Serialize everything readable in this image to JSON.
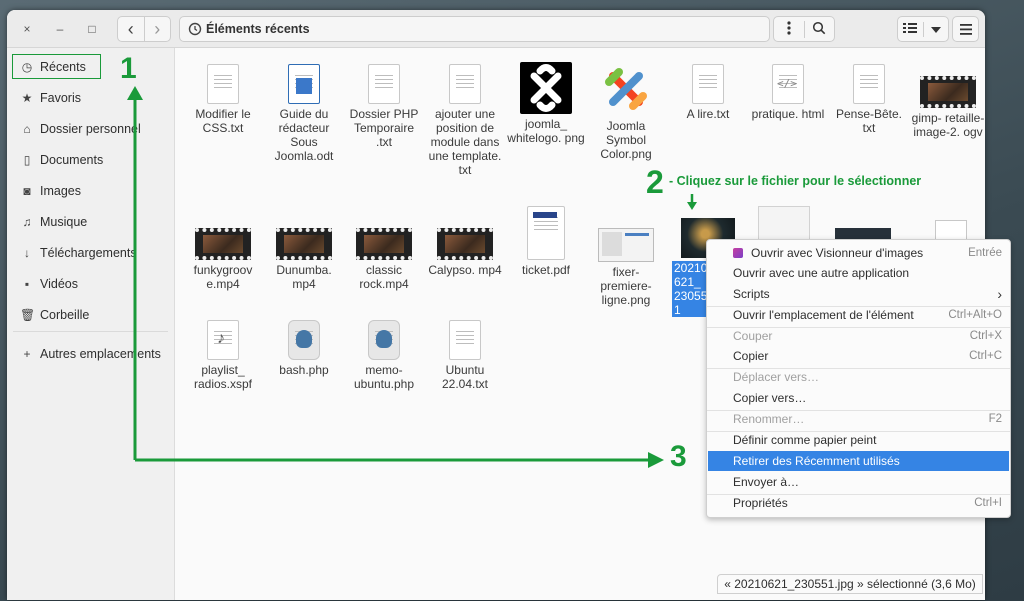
{
  "window": {
    "title": "Éléments récents",
    "controls": {
      "close": "×",
      "minimize": "–",
      "maximize": "□"
    },
    "nav": {
      "back": "‹",
      "forward": "›"
    }
  },
  "sidebar": {
    "items": [
      {
        "label": "Récents",
        "icon": "clock-icon"
      },
      {
        "label": "Favoris",
        "icon": "star-icon"
      },
      {
        "label": "Dossier personnel",
        "icon": "home-icon"
      },
      {
        "label": "Documents",
        "icon": "document-icon"
      },
      {
        "label": "Images",
        "icon": "camera-icon"
      },
      {
        "label": "Musique",
        "icon": "music-icon"
      },
      {
        "label": "Téléchargements",
        "icon": "download-icon"
      },
      {
        "label": "Vidéos",
        "icon": "video-icon"
      },
      {
        "label": "Corbeille",
        "icon": "trash-icon"
      },
      {
        "label": "Autres emplacements",
        "icon": "plus-icon"
      }
    ]
  },
  "files": {
    "row1": [
      {
        "name": "Modifier le CSS.txt",
        "kind": "text"
      },
      {
        "name": "Guide du rédacteur Sous Joomla.odt",
        "kind": "odt"
      },
      {
        "name": "Dossier PHP Temporaire .txt",
        "kind": "text"
      },
      {
        "name": "ajouter une position de module dans une template. txt",
        "kind": "text"
      },
      {
        "name": "joomla_ whitelogo. png",
        "kind": "joomla-white"
      },
      {
        "name": "Joomla Symbol Color.png",
        "kind": "joomla-color"
      },
      {
        "name": "A lire.txt",
        "kind": "text"
      },
      {
        "name": "pratique. html",
        "kind": "html"
      },
      {
        "name": "Pense-Bête. txt",
        "kind": "text"
      },
      {
        "name": "gimp- retaille- image-2. ogv",
        "kind": "video"
      }
    ],
    "row2": [
      {
        "name": "funkygroov e.mp4",
        "kind": "video"
      },
      {
        "name": "Dunumba. mp4",
        "kind": "video"
      },
      {
        "name": "classic rock.mp4",
        "kind": "video"
      },
      {
        "name": "Calypso. mp4",
        "kind": "video"
      },
      {
        "name": "ticket.pdf",
        "kind": "pdf"
      },
      {
        "name": "fixer- premiere- ligne.png",
        "kind": "image"
      },
      {
        "name": "20210621_ 230551",
        "kind": "photo",
        "selected": true
      }
    ],
    "row3": [
      {
        "name": "playlist_ radios.xspf",
        "kind": "playlist"
      },
      {
        "name": "bash.php",
        "kind": "php"
      },
      {
        "name": "memo- ubuntu.php",
        "kind": "php"
      },
      {
        "name": "Ubuntu 22.04.txt",
        "kind": "text"
      }
    ]
  },
  "context_menu": {
    "items": [
      {
        "label": "Ouvrir avec Visionneur d'images",
        "accel": "Entrée",
        "icon": "image-viewer-icon"
      },
      {
        "label": "Ouvrir avec une autre application",
        "accel": ""
      },
      {
        "label": "Scripts",
        "accel": "›"
      },
      {
        "label": "Ouvrir l'emplacement de l'élément",
        "accel": "Ctrl+Alt+O"
      },
      {
        "label": "Couper",
        "accel": "Ctrl+X",
        "disabled": true
      },
      {
        "label": "Copier",
        "accel": "Ctrl+C"
      },
      {
        "label": "Déplacer vers…",
        "accel": "",
        "disabled": true
      },
      {
        "label": "Copier vers…",
        "accel": ""
      },
      {
        "label": "Renommer…",
        "accel": "F2",
        "disabled": true
      },
      {
        "label": "Définir comme papier peint",
        "accel": ""
      },
      {
        "label": "Retirer des Récemment utilisés",
        "accel": "",
        "highlighted": true
      },
      {
        "label": "Envoyer à…",
        "accel": ""
      },
      {
        "label": "Propriétés",
        "accel": "Ctrl+I"
      }
    ]
  },
  "status": "« 20210621_230551.jpg » sélectionné (3,6 Mo)",
  "annotations": {
    "n1": "1",
    "n2": "2",
    "n3": "3",
    "instruction": "- Cliquez sur le fichier pour le sélectionner",
    "color": "#1a9a3a"
  }
}
